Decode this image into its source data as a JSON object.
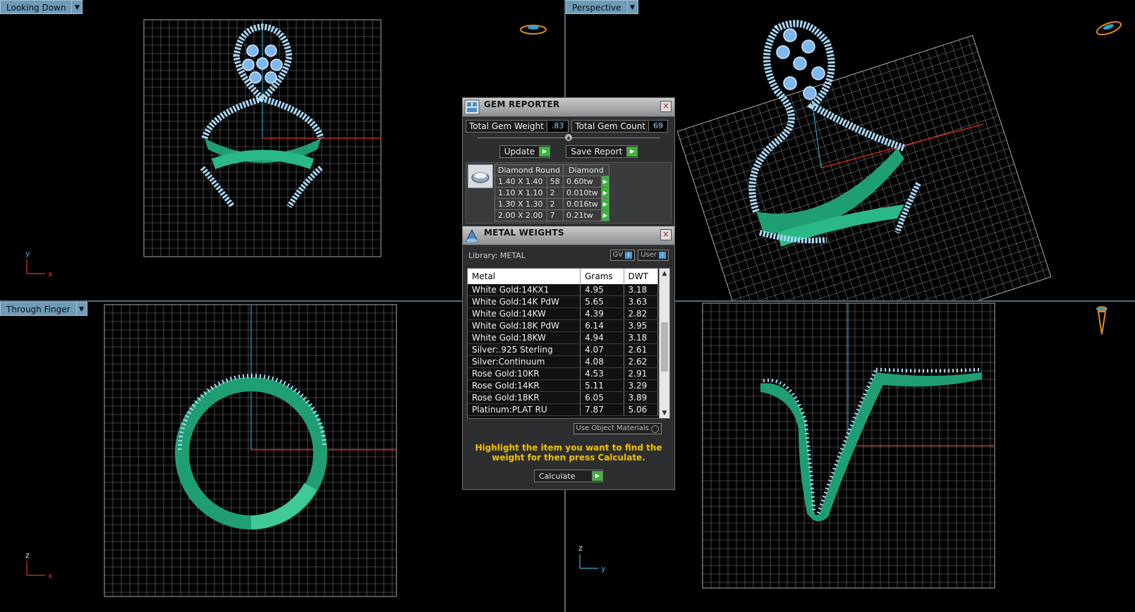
{
  "viewports": [
    {
      "key": "top",
      "label": "Looking Down",
      "axis1": "y",
      "axis2": "x"
    },
    {
      "key": "persp",
      "label": "Perspective"
    },
    {
      "key": "front",
      "label": "Through Finger",
      "axis1": "z",
      "axis2": "x"
    },
    {
      "key": "side",
      "label": "",
      "axis1": "z",
      "axis2": "y"
    }
  ],
  "gem_reporter": {
    "title": "GEM REPORTER",
    "total_weight_label": "Total Gem Weight",
    "total_weight_value": ".83",
    "total_count_label": "Total Gem Count",
    "total_count_value": "69",
    "update_label": "Update",
    "save_label": "Save Report",
    "table_header_shape": "Diamond Round",
    "table_header_type": "Diamond",
    "rows": [
      {
        "size": "1.40 X 1.40",
        "count": "58",
        "weight": "0.60tw"
      },
      {
        "size": "1.10 X 1.10",
        "count": "2",
        "weight": "0.010tw"
      },
      {
        "size": "1.30 X 1.30",
        "count": "2",
        "weight": "0.016tw"
      },
      {
        "size": "2.00 X 2.00",
        "count": "7",
        "weight": "0.21tw"
      }
    ]
  },
  "metal_weights": {
    "title": "METAL WEIGHTS",
    "library_label": "Library: METAL",
    "gv_label": "GV",
    "user_label": "User",
    "col_metal": "Metal",
    "col_grams": "Grams",
    "col_dwt": "DWT",
    "rows": [
      {
        "metal": "White Gold:14KX1",
        "grams": "4.95",
        "dwt": "3.18"
      },
      {
        "metal": "White Gold:14K PdW",
        "grams": "5.65",
        "dwt": "3.63"
      },
      {
        "metal": "White Gold:14KW",
        "grams": "4.39",
        "dwt": "2.82"
      },
      {
        "metal": "White Gold:18K PdW",
        "grams": "6.14",
        "dwt": "3.95"
      },
      {
        "metal": "White Gold:18KW",
        "grams": "4.94",
        "dwt": "3.18"
      },
      {
        "metal": "Silver:.925 Sterling",
        "grams": "4.07",
        "dwt": "2.61"
      },
      {
        "metal": "Silver:Continuum",
        "grams": "4.08",
        "dwt": "2.62"
      },
      {
        "metal": "Rose Gold:10KR",
        "grams": "4.53",
        "dwt": "2.91"
      },
      {
        "metal": "Rose Gold:14KR",
        "grams": "5.11",
        "dwt": "3.29"
      },
      {
        "metal": "Rose Gold:18KR",
        "grams": "6.05",
        "dwt": "3.89"
      },
      {
        "metal": "Platinum:PLAT RU",
        "grams": "7.87",
        "dwt": "5.06"
      }
    ],
    "use_object_label": "Use Object Materials",
    "hint": "Highlight the item you want to find the weight for then press Calculate.",
    "calculate_label": "Calculate"
  },
  "colors": {
    "metal": "#1f9e73",
    "gem": "#a9d6f5",
    "grid": "#8a8a8a",
    "accent": "#6f9bb7"
  }
}
